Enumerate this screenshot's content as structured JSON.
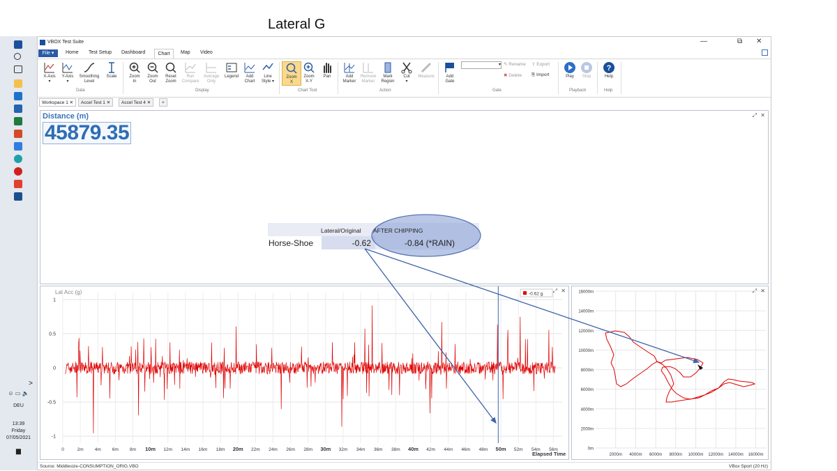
{
  "slide": {
    "title": "Lateral G"
  },
  "taskbar": {
    "lang": "DEU",
    "time": "13:39",
    "day": "Friday",
    "date": "07/05/2021",
    "chevron": ">",
    "tray_icons": [
      "people-icon",
      "battery-icon",
      "volume-icon"
    ]
  },
  "window": {
    "title": "VBOX Test Suite",
    "controls": {
      "minimize": "—",
      "maximize": "⧉",
      "close": "✕"
    }
  },
  "menu": {
    "file": "File ▾",
    "tabs": [
      "Home",
      "Test Setup",
      "Dashboard",
      "Chart",
      "Map",
      "Video"
    ],
    "active_tab": "Chart"
  },
  "ribbon": {
    "buttons": [
      {
        "label": "X-Axis",
        "sub": "▾",
        "icon": "x-axis-icon"
      },
      {
        "label": "Y-Axis",
        "sub": "▾",
        "icon": "y-axis-icon"
      },
      {
        "label": "Smoothing",
        "sub": "Level",
        "icon": "smoothing-icon"
      },
      {
        "label": "Scale",
        "sub": "",
        "icon": "scale-icon"
      },
      {
        "label": "Zoom",
        "sub": "In",
        "icon": "zoom-in-icon"
      },
      {
        "label": "Zoom",
        "sub": "Out",
        "icon": "zoom-out-icon"
      },
      {
        "label": "Reset",
        "sub": "Zoom",
        "icon": "reset-zoom-icon"
      },
      {
        "label": "Run",
        "sub": "Compare",
        "icon": "run-compare-icon"
      },
      {
        "label": "Average",
        "sub": "Only",
        "icon": "average-icon"
      },
      {
        "label": "Legend",
        "sub": "",
        "icon": "legend-icon"
      },
      {
        "label": "Add",
        "sub": "Chart",
        "icon": "add-chart-icon"
      },
      {
        "label": "Line",
        "sub": "Style ▾",
        "icon": "line-style-icon"
      },
      {
        "label": "Zoom",
        "sub": "X",
        "icon": "zoom-x-icon"
      },
      {
        "label": "Zoom",
        "sub": "X-Y",
        "icon": "zoom-xy-icon"
      },
      {
        "label": "Pan",
        "sub": "",
        "icon": "pan-icon"
      },
      {
        "label": "Add",
        "sub": "Marker",
        "icon": "add-marker-icon"
      },
      {
        "label": "Remove",
        "sub": "Marker",
        "icon": "remove-marker-icon"
      },
      {
        "label": "Mark",
        "sub": "Region",
        "icon": "mark-region-icon"
      },
      {
        "label": "Cut",
        "sub": "▾",
        "icon": "cut-icon"
      },
      {
        "label": "Measure",
        "sub": "",
        "icon": "measure-icon"
      },
      {
        "label": "Add",
        "sub": "Gate",
        "icon": "add-gate-icon"
      },
      {
        "label": "Play",
        "sub": "",
        "icon": "play-icon"
      },
      {
        "label": "Stop",
        "sub": "",
        "icon": "stop-icon"
      },
      {
        "label": "Help",
        "sub": "",
        "icon": "help-icon"
      }
    ],
    "groups": [
      "Data",
      "Display",
      "Chart Tool",
      "Action",
      "Gate",
      "Playback",
      "Help"
    ],
    "gate": {
      "rename": "Rename",
      "delete": "Delete",
      "export": "Export",
      "import": "Import"
    }
  },
  "workspace_tabs": [
    "Workspace 1",
    "Accel Test 1",
    "Accel Test 4"
  ],
  "workspace_add": "+",
  "panel_controls": {
    "expand": "⤢",
    "close": "✕"
  },
  "distance": {
    "label": "Distance (m)",
    "value": "45879.35"
  },
  "overlay": {
    "col1": "Lateral/Original",
    "col2": "AFTER CHIPPING",
    "row_label": "Horse-Shoe",
    "val1": "-0.62",
    "val2": "-0.84 (*RAIN)"
  },
  "lat_chart": {
    "title": "Lat Acc (g)",
    "legend_value": "-0.62 g",
    "y_ticks": [
      "1",
      "0.5",
      "0",
      "-0.5",
      "-1"
    ],
    "x_ticks": [
      "0",
      "2m",
      "4m",
      "6m",
      "8m",
      "10m",
      "12m",
      "14m",
      "16m",
      "18m",
      "20m",
      "22m",
      "24m",
      "26m",
      "28m",
      "30m",
      "32m",
      "34m",
      "36m",
      "38m",
      "40m",
      "42m",
      "44m",
      "46m",
      "48m",
      "50m",
      "52m",
      "54m",
      "56m"
    ],
    "bold_ticks": [
      "10m",
      "20m",
      "30m",
      "40m",
      "50m"
    ],
    "x_axis_label": "Elapsed Time",
    "cursor_time_min": 49.7
  },
  "map_chart": {
    "y_ticks": [
      "16000m",
      "14000m",
      "12000m",
      "10000m",
      "8000m",
      "6000m",
      "4000m",
      "2000m",
      "0m"
    ],
    "x_ticks": [
      "2000m",
      "4000m",
      "6000m",
      "8000m",
      "10000m",
      "12000m",
      "14000m",
      "16000m"
    ]
  },
  "chart_data": {
    "type": "line",
    "title": "",
    "ylabel": "Lat Acc (g)",
    "xlabel": "Elapsed Time",
    "ylim": [
      -1.1,
      1.1
    ],
    "xlim_min": [
      0,
      57
    ],
    "series": [
      {
        "name": "Lat Acc (g)",
        "color": "#e00000"
      }
    ],
    "annotation_value_g": -0.62
  },
  "status": {
    "source": "Source: Middlesize-CONSUMPTION_ORIG.VBO",
    "device": "VBox Sport (20 Hz)"
  },
  "colors": {
    "accent": "#2f6db5",
    "series": "#e00000",
    "arrow": "#3d63a8",
    "ellipse": "#8aa3d6"
  }
}
